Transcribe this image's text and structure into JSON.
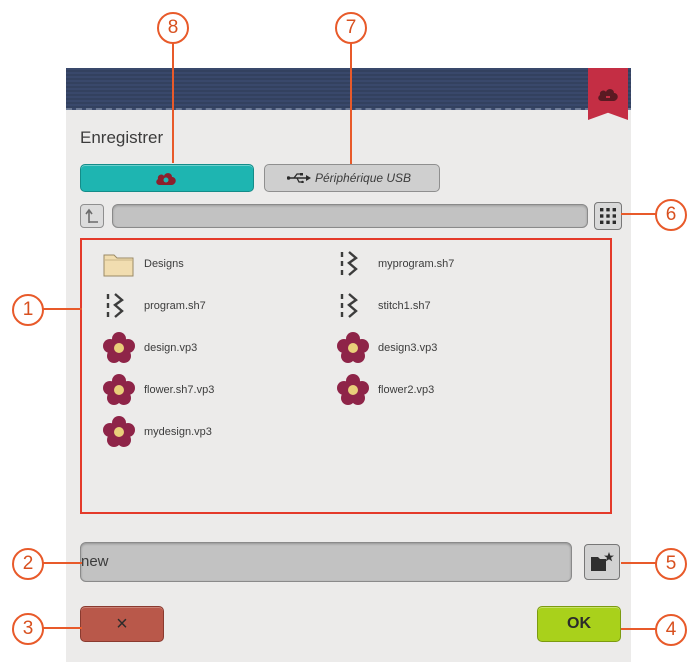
{
  "dialog": {
    "title": "Enregistrer",
    "tabs": {
      "cloud_icon": "cloud-icon",
      "usb_label": "Périphérique USB",
      "usb_icon": "usb-icon"
    },
    "path_value": "",
    "files": [
      {
        "name": "Designs",
        "icon": "folder-icon"
      },
      {
        "name": "myprogram.sh7",
        "icon": "stitch-program-icon"
      },
      {
        "name": "program.sh7",
        "icon": "stitch-program-icon"
      },
      {
        "name": "stitch1.sh7",
        "icon": "stitch-program-icon"
      },
      {
        "name": "design.vp3",
        "icon": "embroidery-flower-icon"
      },
      {
        "name": "design3.vp3",
        "icon": "embroidery-flower-icon"
      },
      {
        "name": "flower.sh7.vp3",
        "icon": "embroidery-flower-icon"
      },
      {
        "name": "flower2.vp3",
        "icon": "embroidery-flower-icon"
      },
      {
        "name": "mydesign.vp3",
        "icon": "embroidery-flower-icon"
      }
    ],
    "filename_value": "new",
    "cancel_label": "×",
    "ok_label": "OK"
  },
  "callouts": [
    "1",
    "2",
    "3",
    "4",
    "5",
    "6",
    "7",
    "8"
  ],
  "colors": {
    "accent_teal": "#1eb5b1",
    "ok_green": "#a9d11b",
    "cancel_red": "#b9584a",
    "callout_orange": "#e85a2a",
    "header_navy": "#39486b",
    "cloud_tab_red": "#c42e44"
  }
}
